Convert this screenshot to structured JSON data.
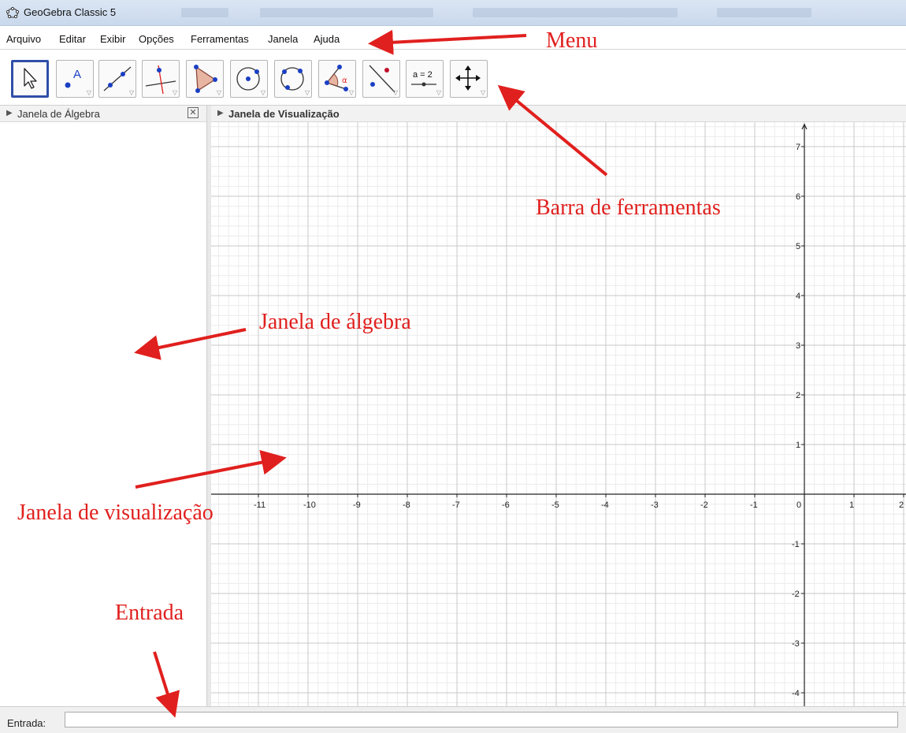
{
  "window": {
    "title": "GeoGebra Classic 5"
  },
  "menu": [
    "Arquivo",
    "Editar",
    "Exibir",
    "Opções",
    "Ferramentas",
    "Janela",
    "Ajuda"
  ],
  "toolbar": {
    "tools": [
      {
        "name": "move-tool",
        "icon": "arrow-cursor-icon"
      },
      {
        "name": "point-tool",
        "icon": "point-icon",
        "glyph": "A"
      },
      {
        "name": "line-tool",
        "icon": "line-through-points-icon"
      },
      {
        "name": "perpendicular-line-tool",
        "icon": "perpendicular-line-icon"
      },
      {
        "name": "polygon-tool",
        "icon": "polygon-icon"
      },
      {
        "name": "circle-tool",
        "icon": "circle-center-point-icon"
      },
      {
        "name": "circle-three-points-tool",
        "icon": "circle-three-points-icon"
      },
      {
        "name": "angle-tool",
        "icon": "angle-icon",
        "glyph": "α"
      },
      {
        "name": "reflect-tool",
        "icon": "reflect-about-line-icon"
      },
      {
        "name": "slider-tool",
        "icon": "slider-icon",
        "glyph": "a = 2"
      },
      {
        "name": "move-graphics-view-tool",
        "icon": "move-cross-icon"
      }
    ]
  },
  "algebra": {
    "title": "Janela de Álgebra"
  },
  "graphics": {
    "title": "Janela de Visualização",
    "x_ticks": [
      "-11",
      "-10",
      "-9",
      "-8",
      "-7",
      "-6",
      "-5",
      "-4",
      "-3",
      "-2",
      "-1",
      "0",
      "1",
      "2"
    ],
    "y_ticks": [
      "7",
      "6",
      "5",
      "4",
      "3",
      "2",
      "1",
      "-1",
      "-2",
      "-3",
      "-4"
    ]
  },
  "input": {
    "label": "Entrada:",
    "value": ""
  },
  "annotations": {
    "menu": "Menu",
    "toolbar": "Barra de ferramentas",
    "algebra": "Janela de álgebra",
    "graphics": "Janela de visualização",
    "input": "Entrada"
  },
  "colors": {
    "annotation": "#e0201e",
    "active_tool": "#2f4fa8",
    "point": "#1a3fc4"
  }
}
